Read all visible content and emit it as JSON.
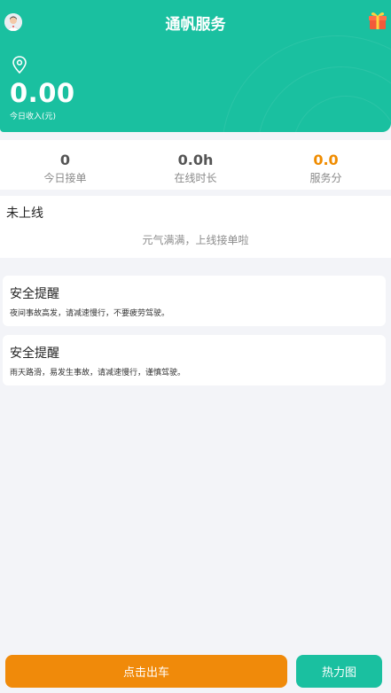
{
  "header": {
    "title": "通帆服务",
    "income_value": "0.00",
    "income_label": "今日收入(元)",
    "avatar_icon": "user-avatar-icon",
    "gift_icon": "gift-icon",
    "location_icon": "location-pin-icon",
    "bg_color": "#1ac0a0"
  },
  "stats": [
    {
      "value": "0",
      "label": "今日接单"
    },
    {
      "value": "0.0h",
      "label": "在线时长"
    },
    {
      "value": "0.0",
      "label": "服务分",
      "color": "#f08c00"
    }
  ],
  "status": {
    "title": "未上线",
    "subtitle": "元气满满，上线接单啦"
  },
  "notices": [
    {
      "title": "安全提醒",
      "body": "夜间事故高发，请减速慢行，不要疲劳驾驶。"
    },
    {
      "title": "安全提醒",
      "body": "雨天路滑，易发生事故，请减速慢行，谨慎驾驶。"
    }
  ],
  "actions": {
    "primary_label": "点击出车",
    "primary_color": "#f08a0a",
    "heatmap_label": "热力图"
  }
}
